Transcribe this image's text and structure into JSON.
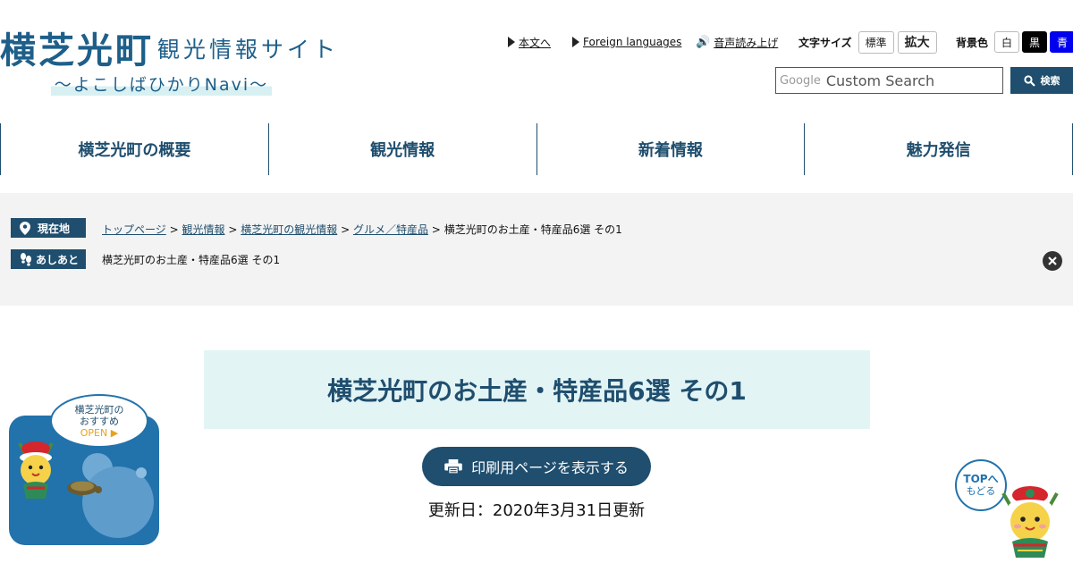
{
  "header": {
    "logo_main": "横芝光町",
    "logo_sub": "観光情報サイト",
    "logo_navi": "～よこしばひかりNavi～",
    "skip_label": "本文へ",
    "foreign_label": "Foreign languages",
    "speech_label": "音声読み上げ",
    "font_size_label": "文字サイズ",
    "font_standard": "標準",
    "font_large": "拡大",
    "bg_label": "背景色",
    "bg_white": "白",
    "bg_black": "黒",
    "bg_blue": "青",
    "search_brand": "Google",
    "search_placeholder": "Custom Search",
    "search_button": "検索"
  },
  "nav": {
    "items": [
      "横芝光町の概要",
      "観光情報",
      "新着情報",
      "魅力発信"
    ]
  },
  "breadcrumb": {
    "current_label": "現在地",
    "history_label": "あしあと",
    "sep": ">",
    "links": [
      "トップページ",
      "観光情報",
      "横芝光町の観光情報",
      "グルメ／特産品"
    ],
    "current": "横芝光町のお土産・特産品6選 その1",
    "history_item": "横芝光町のお土産・特産品6選 その1"
  },
  "main": {
    "title": "横芝光町のお土産・特産品6選 その1",
    "print_label": "印刷用ページを表示する",
    "updated": "更新日：2020年3月31日更新"
  },
  "widgets": {
    "reco_line1": "横芝光町の",
    "reco_line2": "おすすめ",
    "reco_open": "OPEN",
    "top_line1": "TOPへ",
    "top_line2": "もどる"
  },
  "colors": {
    "brand": "#1f4e6e",
    "title_bg": "#e3f4f5",
    "band_bg": "#f3f3f3",
    "widget_blue": "#2272ab"
  }
}
